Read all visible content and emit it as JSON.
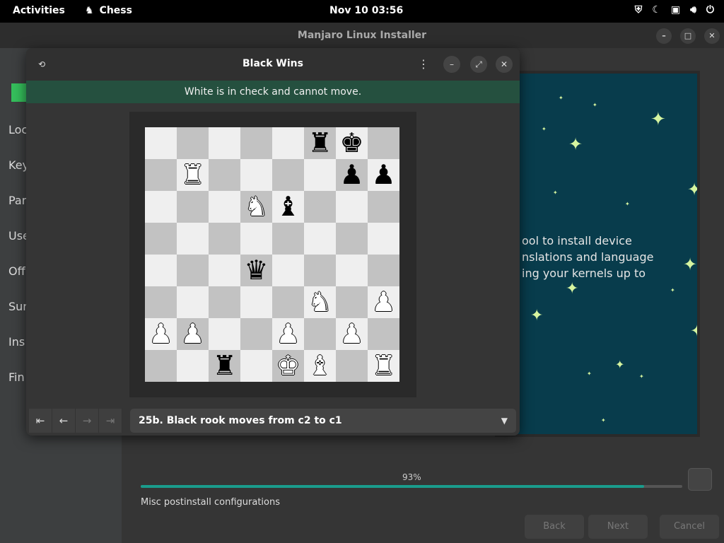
{
  "topbar": {
    "activities": "Activities",
    "app_name": "Chess",
    "clock": "Nov 10  03:56"
  },
  "installer": {
    "title": "Manjaro Linux Installer",
    "sidebar": [
      "Loc",
      "Key",
      "Par",
      "Use",
      "Off",
      "Sur",
      "Ins",
      "Fin"
    ],
    "slide_text": [
      "ool to install device",
      "nslations and language",
      "ing your kernels up to"
    ],
    "progress": {
      "percent_label": "93%",
      "value": 0.93,
      "status": "Misc postinstall configurations"
    },
    "buttons": {
      "back": "Back",
      "next": "Next",
      "cancel": "Cancel"
    }
  },
  "chess": {
    "title": "Black Wins",
    "status_banner": "White is in check and cannot move.",
    "move_label": "25b. Black rook moves from c2 to c1",
    "board": [
      "     rk ",
      " R    pp",
      "   Nb   ",
      "        ",
      "   q    ",
      "     N P",
      "PP  P P ",
      "  r KB R"
    ]
  }
}
